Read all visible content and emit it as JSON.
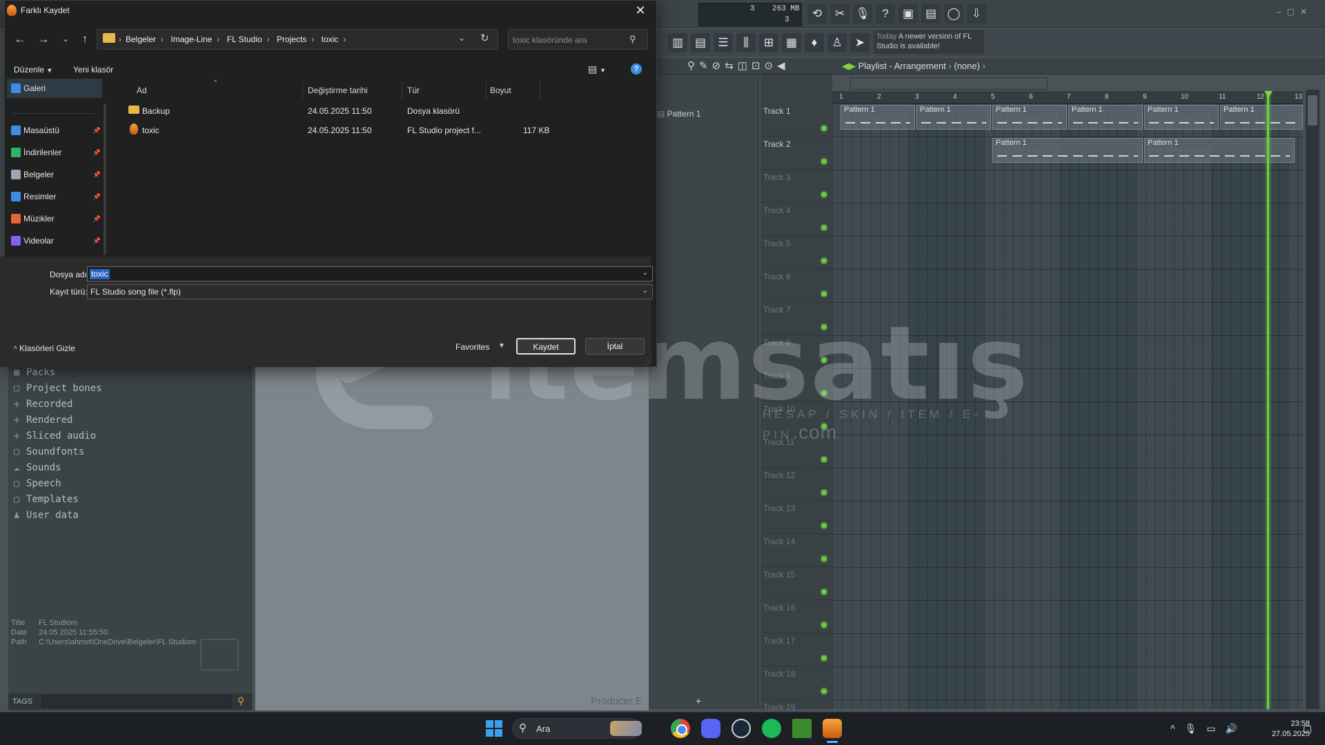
{
  "dialog": {
    "title": "Farklı Kaydet",
    "close_glyph": "✕",
    "address": {
      "crumbs": [
        "Belgeler",
        "Image-Line",
        "FL Studio",
        "Projects",
        "toxic"
      ]
    },
    "search_placeholder": "toxic klasöründe ara",
    "toolbar": {
      "organize_label": "Düzenle",
      "new_folder_label": "Yeni klasör"
    },
    "nav_items": [
      {
        "label": "Galeri",
        "color": "#3b8fe2",
        "pinned": false,
        "selected": true
      },
      {
        "label": "Masaüstü",
        "color": "#3b8fe2",
        "pinned": true
      },
      {
        "label": "İndirilenler",
        "color": "#2fb36b",
        "pinned": true
      },
      {
        "label": "Belgeler",
        "color": "#9aa8b8",
        "pinned": true
      },
      {
        "label": "Resimler",
        "color": "#3b8fe2",
        "pinned": true
      },
      {
        "label": "Müzikler",
        "color": "#e8643c",
        "pinned": true
      },
      {
        "label": "Videolar",
        "color": "#8b5cf6",
        "pinned": true
      }
    ],
    "columns": [
      "Ad",
      "Değiştirme tarihi",
      "Tür",
      "Boyut"
    ],
    "files": [
      {
        "name": "Backup",
        "modified": "24.05.2025 11:50",
        "type": "Dosya klasörü",
        "size": "",
        "icon": "folder-icon"
      },
      {
        "name": "toxic",
        "modified": "24.05.2025 11:50",
        "type": "FL Studio project f...",
        "size": "117 KB",
        "icon": "flp-file-icon"
      }
    ],
    "filename_label": "Dosya adı:",
    "filename_value": "toxic",
    "filetype_label": "Kayıt türü:",
    "filetype_value": "FL Studio song file (*.flp)",
    "hide_folders_label": "Klasörleri Gizle",
    "favorites_label": "Favorites",
    "save_label": "Kaydet",
    "cancel_label": "İptal"
  },
  "fl": {
    "cpu_value": "3",
    "memory": "263 MB",
    "poly": "3",
    "news_when": "Today",
    "news_text": "A newer version of FL Studio is available!",
    "playlist_title": "Playlist - Arrangement",
    "playlist_pattern": "(none)",
    "pattern_item": "Pattern 1",
    "clip_label": "Pattern 1",
    "ruler": [
      "1",
      "2",
      "3",
      "4",
      "5",
      "6",
      "7",
      "8",
      "9",
      "10",
      "11",
      "12",
      "13"
    ],
    "tracks": [
      "Track 1",
      "Track 2",
      "Track 3",
      "Track 4",
      "Track 5",
      "Track 6",
      "Track 7",
      "Track 8",
      "Track 9",
      "Track 10",
      "Track 11",
      "Track 12",
      "Track 13",
      "Track 14",
      "Track 15",
      "Track 16",
      "Track 17",
      "Track 18",
      "Track 19"
    ],
    "browser_items": [
      {
        "label": "Packs",
        "icon": "▦"
      },
      {
        "label": "Project bones",
        "icon": "▢"
      },
      {
        "label": "Recorded",
        "icon": "✛"
      },
      {
        "label": "Rendered",
        "icon": "✛"
      },
      {
        "label": "Sliced audio",
        "icon": "✛"
      },
      {
        "label": "Soundfonts",
        "icon": "▢"
      },
      {
        "label": "Sounds",
        "icon": "☁"
      },
      {
        "label": "Speech",
        "icon": "▢"
      },
      {
        "label": "Templates",
        "icon": "▢"
      },
      {
        "label": "User data",
        "icon": "♟"
      }
    ],
    "meta": {
      "title_key": "Title",
      "title_val": "FL Studiom",
      "date_key": "Date",
      "date_val": "24.05.2025 11:55:50",
      "path_key": "Path",
      "path_val": "C:\\Users\\ahmet\\OneDrive\\Belgeler\\FL Studiom"
    },
    "tags_label": "TAGS",
    "producer_text": "Producer E",
    "add_track": "+"
  },
  "watermark": {
    "text": "itemsatış",
    "sub": "HESAP / SKIN / ITEM / E-PIN",
    "suffix": ".com"
  },
  "taskbar": {
    "search_label": "Ara",
    "time": "23:58",
    "date": "27.05.2025"
  }
}
